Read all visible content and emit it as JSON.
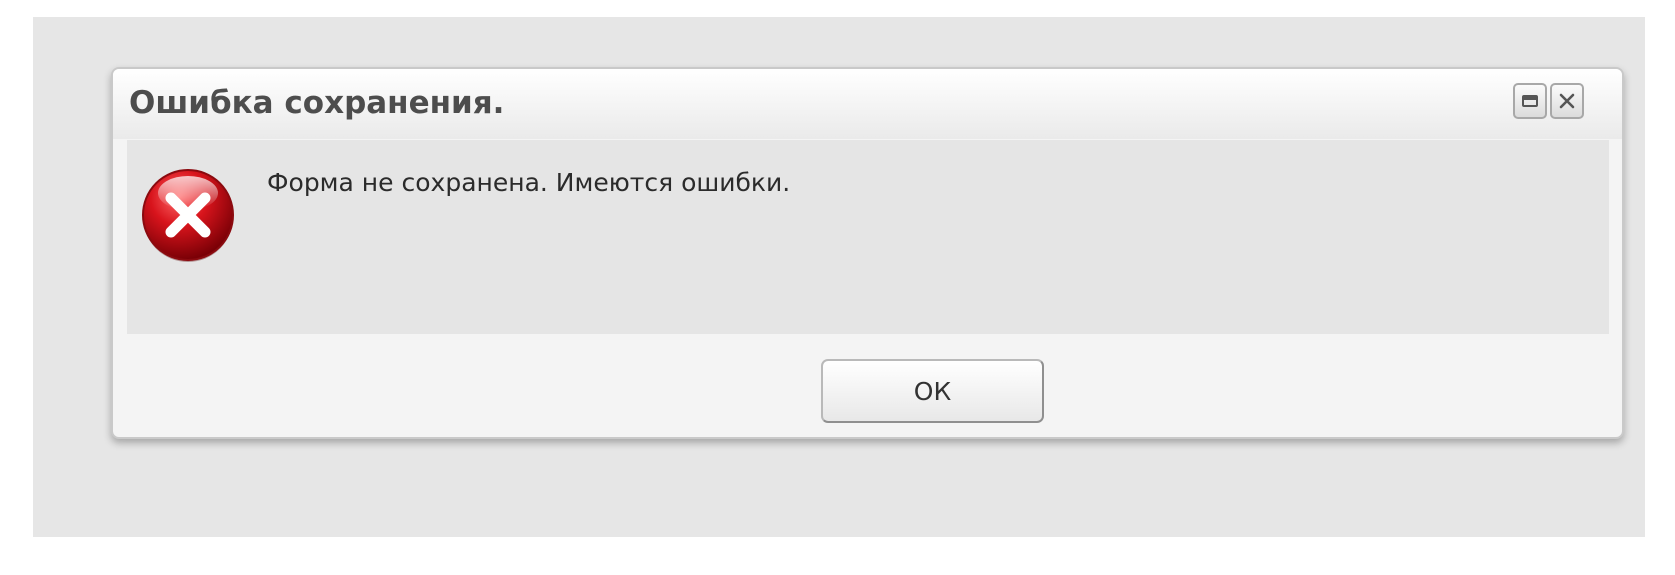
{
  "dialog": {
    "title": "Ошибка сохранения.",
    "message": "Форма не сохранена. Имеются ошибки.",
    "ok_label": "ОК",
    "icons": {
      "maximize": "maximize-icon",
      "close": "close-icon",
      "status": "error-icon"
    }
  },
  "colors": {
    "error_red": "#d0161d",
    "title_text": "#4d4d4d"
  }
}
